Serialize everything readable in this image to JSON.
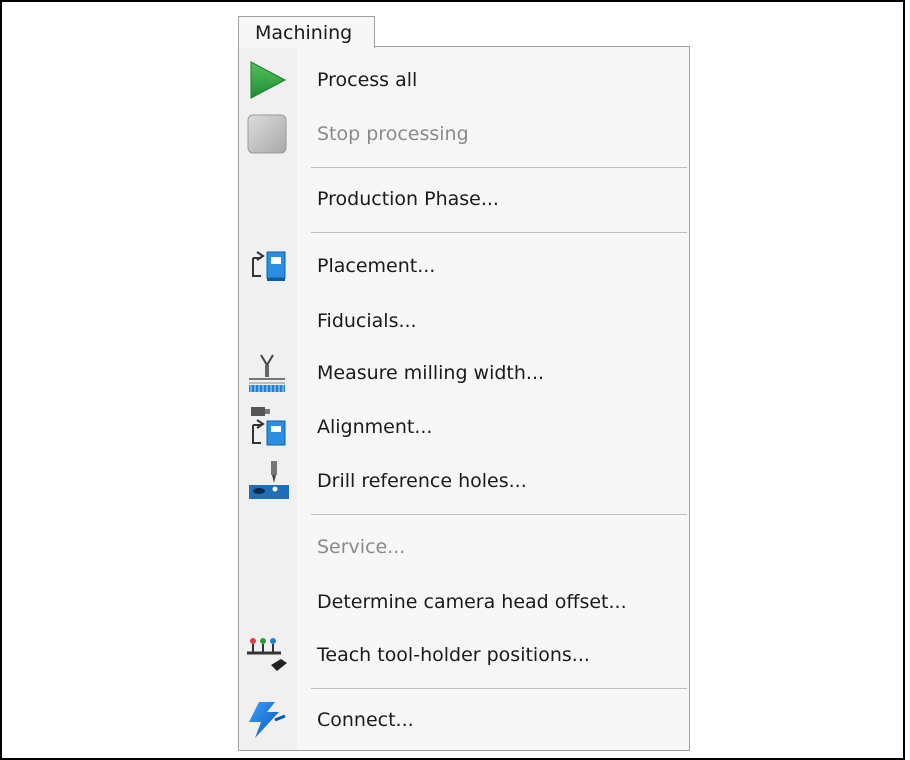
{
  "menu": {
    "title": "Machining",
    "items": [
      {
        "label": "Process all",
        "icon": "play-icon",
        "enabled": true
      },
      {
        "label": "Stop processing",
        "icon": "stop-icon",
        "enabled": false
      },
      {
        "label": "Production Phase...",
        "icon": "",
        "enabled": true
      },
      {
        "label": "Placement...",
        "icon": "placement-icon",
        "enabled": true
      },
      {
        "label": "Fiducials...",
        "icon": "",
        "enabled": true
      },
      {
        "label": "Measure milling width...",
        "icon": "milling-width-icon",
        "enabled": true
      },
      {
        "label": "Alignment...",
        "icon": "alignment-icon",
        "enabled": true
      },
      {
        "label": "Drill reference holes...",
        "icon": "drill-icon",
        "enabled": true
      },
      {
        "label": "Service...",
        "icon": "",
        "enabled": false
      },
      {
        "label": "Determine camera head offset...",
        "icon": "",
        "enabled": true
      },
      {
        "label": "Teach tool-holder positions...",
        "icon": "tool-holder-icon",
        "enabled": true
      },
      {
        "label": "Connect...",
        "icon": "connect-icon",
        "enabled": true
      }
    ]
  },
  "colors": {
    "play_green": "#2ea043",
    "stop_gray": "#c8c8c8",
    "icon_blue": "#1f7fd1",
    "disabled_text": "#8a8a8a"
  }
}
